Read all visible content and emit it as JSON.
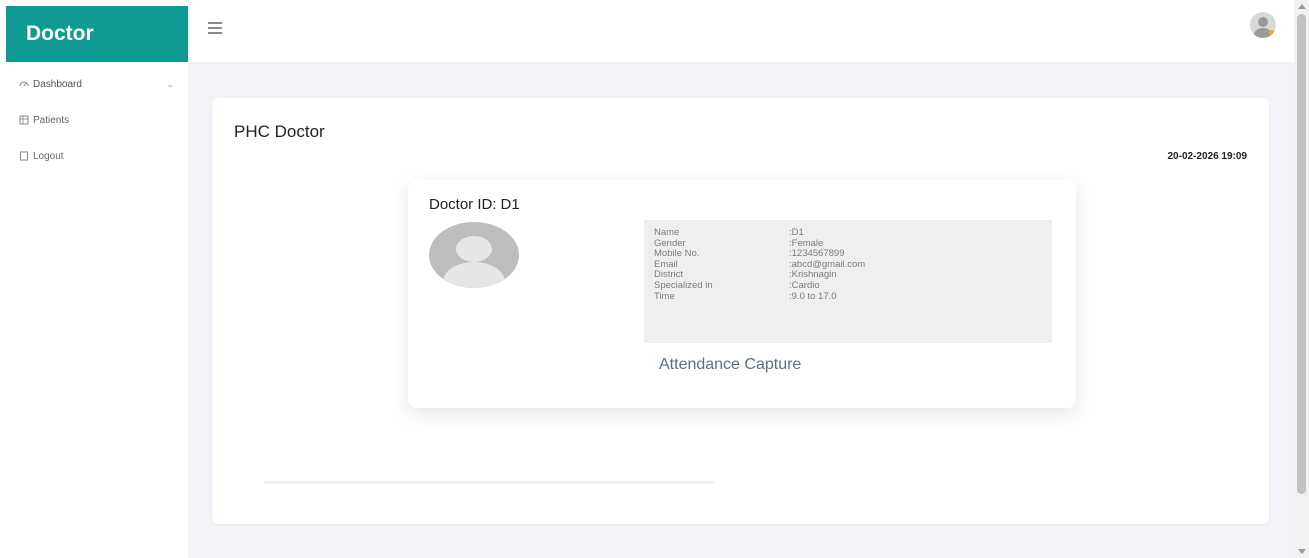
{
  "sidebar": {
    "brand": "Doctor",
    "items": [
      {
        "label": "Dashboard",
        "icon": "dashboard-icon"
      },
      {
        "label": "Patients",
        "icon": "patients-icon"
      },
      {
        "label": "Logout",
        "icon": "logout-icon"
      }
    ]
  },
  "topbar": {
    "menu_icon": "hamburger-icon",
    "avatar_icon": "user-avatar-icon"
  },
  "main": {
    "title": "PHC Doctor",
    "datetime": "20-02-2026 19:09",
    "profile": {
      "id_label": "Doctor ID:",
      "id_value": "D1",
      "fields": [
        {
          "label": "Name",
          "value": "D1"
        },
        {
          "label": "Gender",
          "value": "Female"
        },
        {
          "label": "Mobile No.",
          "value": "1234567899"
        },
        {
          "label": "Email",
          "value": "abcd@gmail.com"
        },
        {
          "label": "District",
          "value": "Krishnagin"
        },
        {
          "label": "Specialized in",
          "value": "Cardio"
        },
        {
          "label": "Time",
          "value": "9.0 to 17.0"
        }
      ],
      "attendance_link": "Attendance Capture"
    }
  },
  "colors": {
    "brand": "#0f9b94",
    "background": "#f3f2f8",
    "info_box": "#efefef",
    "link": "#5f6f80"
  }
}
